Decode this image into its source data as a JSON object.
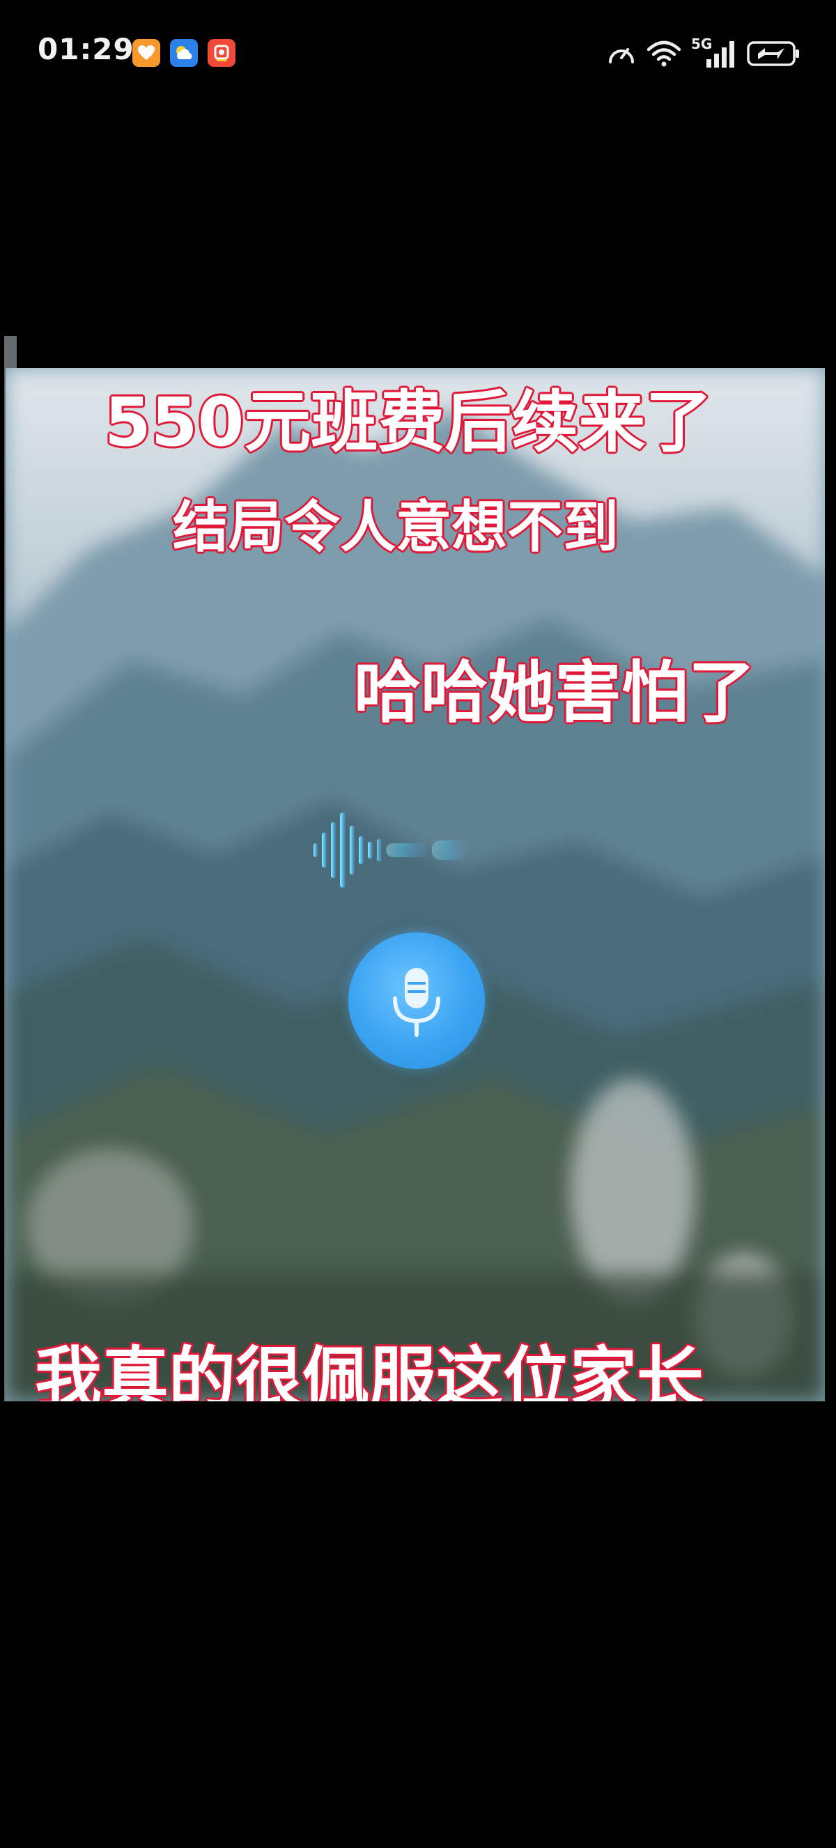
{
  "status_bar": {
    "time": "01:29",
    "network_label": "5G",
    "icons": [
      "orange-heart-app-icon",
      "weather-app-icon",
      "red-camera-app-icon",
      "speed-icon",
      "wifi-icon",
      "signal-5g-icon",
      "battery-charging-icon"
    ]
  },
  "video": {
    "captions": {
      "line1": "550元班费后续来了",
      "line2": "结局令人意想不到",
      "line3": "哈哈她害怕了",
      "bottom": "我真的很佩服这位家长"
    },
    "colors": {
      "caption_outline": "#e01a3a",
      "caption_fill": "#ffffff",
      "mic_button": "#3aa3f2"
    },
    "icons": [
      "voice-waveform-icon",
      "microphone-icon"
    ]
  }
}
